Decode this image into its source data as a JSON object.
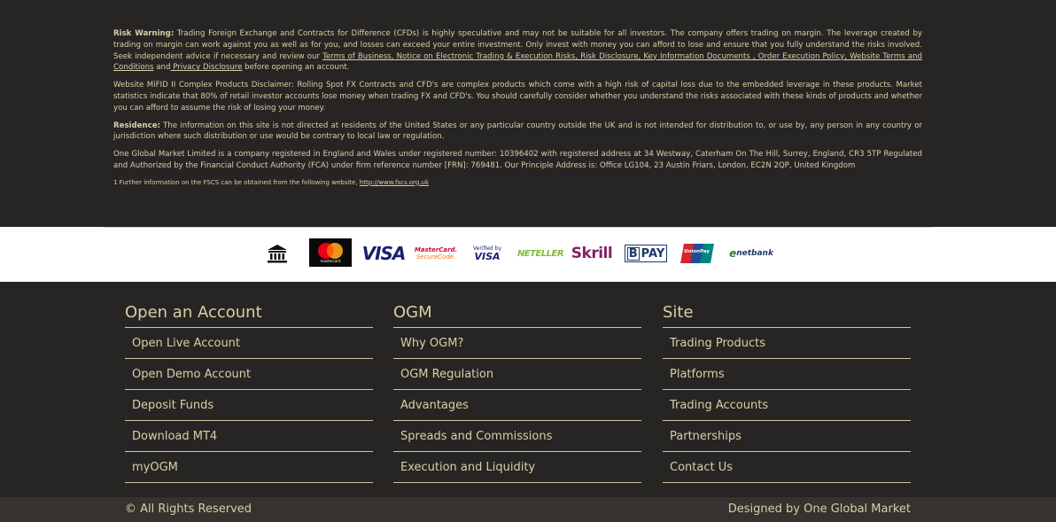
{
  "disclaimer": {
    "risk_label": "Risk Warning:",
    "risk_text": " Trading Foreign Exchange and Contracts for Difference (CFDs) is highly speculative and may not be suitable for all investors. The company offers trading on margin. The leverage created by trading on margin can work against you as well as for you, and losses can exceed your entire investment. Only invest with money you can afford to lose and ensure that you fully understand the risks involved. Seek independent advice if necessary and review our ",
    "links": [
      "Terms of Business, Notice on Electronic Trading & Execution Risks, Risk Disclosure, Key Information Documents , Order Execution Policy, Website Terms and Conditions",
      " Privacy Disclosure"
    ],
    "and_text": " and",
    "risk_tail": " before opening an account.",
    "mifid_text": "Website MiFID II Complex Products Disclaimer: Rolling Spot FX Contracts and CFD's are complex products which come with a high risk of capital loss due to the embedded leverage in these products. Market statistics indicate that 80% of retail investor accounts lose money when trading FX and CFD's. You should carefully consider whether you understand the risks associated with these kinds of products and whether you can afford to assume the risk of losing your money.",
    "residence_label": "Residence:",
    "residence_text": " The information on this site is not directed at residents of the United States or any particular country outside the UK and is not intended for distribution to, or use by, any person in any country or jurisdiction where such distribution or use would be contrary to local law or regulation.",
    "company_text": "One Global Market Limited is a company registered in England and Wales under registered number: 10396402 with registered address at 34 Westway, Caterham On The Hill, Surrey, England, CR3 5TP Regulated and Authorized by the Financial Conduct Authority (FCA) under firm reference number [FRN]: 769481. Our Principle Address is: Office LG104, 23 Austin Friars, London, EC2N 2QP, United Kingdom",
    "footnote_text": "1 Further information on the FSCS can be obtained from the following website, ",
    "footnote_link": "http://www.fscs.org.uk"
  },
  "payment_logos": {
    "visa": "VISA",
    "mastercard_small": "mastercard",
    "mc_securecode_1": "MasterCard.",
    "mc_securecode_2": "SecureCode.",
    "verified_by_1": "Verified by",
    "verified_by_2": "VISA",
    "neteller": "NETELLER",
    "skrill": "Skrill",
    "ibpay_b": "B",
    "ibpay": "PAY",
    "unionpay": "UnionPay",
    "netbank": "netbank"
  },
  "footer": {
    "columns": [
      {
        "title": "Open an Account",
        "items": [
          "Open Live Account",
          "Open Demo Account",
          "Deposit Funds",
          "Download MT4",
          "myOGM"
        ]
      },
      {
        "title": "OGM",
        "items": [
          "Why OGM?",
          "OGM Regulation",
          "Advantages",
          "Spreads and Commissions",
          "Execution and Liquidity"
        ]
      },
      {
        "title": "Site",
        "items": [
          "Trading Products",
          "Platforms",
          "Trading Accounts",
          "Partnerships",
          "Contact Us"
        ]
      }
    ],
    "copyright": "© All Rights Reserved",
    "designed_by": "Designed by One Global Market"
  }
}
